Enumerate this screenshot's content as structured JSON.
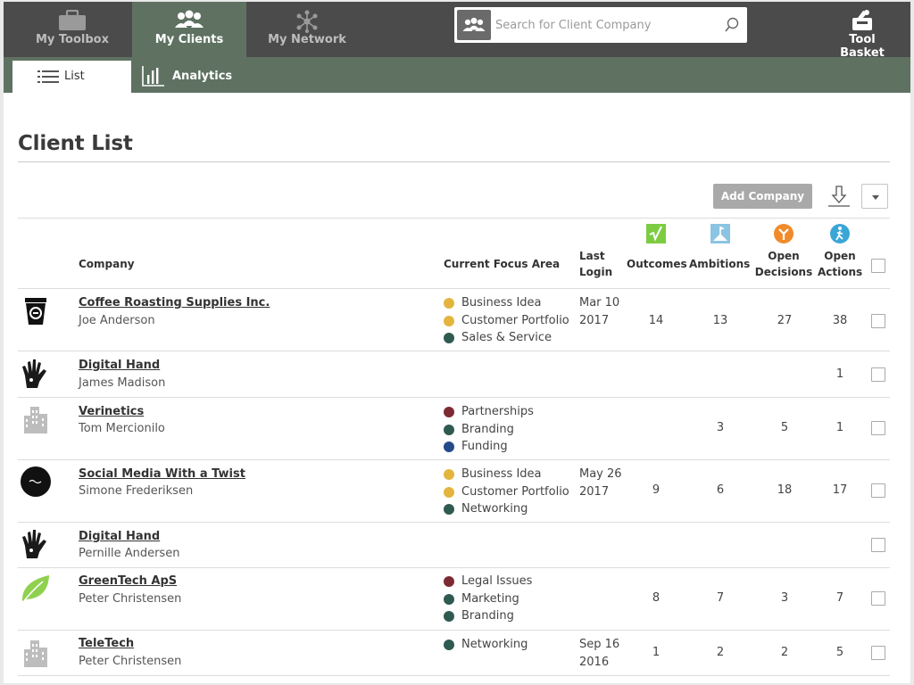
{
  "nav": {
    "toolbox": "My Toolbox",
    "clients": "My Clients",
    "network": "My Network",
    "basket": "Tool Basket"
  },
  "search": {
    "placeholder": "Search for Client Company"
  },
  "subnav": {
    "list": "List",
    "analytics": "Analytics"
  },
  "page": {
    "title": "Client List",
    "add_company": "Add Company"
  },
  "columns": {
    "company": "Company",
    "focus": "Current Focus Area",
    "last_login_1": "Last",
    "last_login_2": "Login",
    "outcomes": "Outcomes",
    "ambitions": "Ambitions",
    "decisions_1": "Open",
    "decisions_2": "Decisions",
    "actions_1": "Open",
    "actions_2": "Actions"
  },
  "colors": {
    "nav_bg": "#4b4b4b",
    "accent": "#5f7262",
    "focus_yellow": "#e3b53e",
    "focus_green": "#2f5a52",
    "focus_red": "#7d2b33",
    "focus_blue": "#244a8a",
    "outcomes_icon": "#7ccc41",
    "ambitions_icon": "#8cc4e3",
    "decisions_icon": "#f08a2a",
    "actions_icon": "#3aa6d6"
  },
  "rows": [
    {
      "logo": "coffee-cup-logo",
      "company": "Coffee Roasting Supplies Inc.",
      "contact": "Joe Anderson",
      "focus": [
        {
          "label": "Business Idea",
          "color": "#e3b53e"
        },
        {
          "label": "Customer Portfolio",
          "color": "#e3b53e"
        },
        {
          "label": "Sales & Service",
          "color": "#2f5a52"
        }
      ],
      "login": [
        "Mar 10",
        "2017"
      ],
      "outcomes": "14",
      "ambitions": "13",
      "decisions": "27",
      "actions": "38"
    },
    {
      "logo": "hand-print-logo",
      "company": "Digital Hand ",
      "contact": "James Madison",
      "focus": [],
      "login": [],
      "outcomes": "",
      "ambitions": "",
      "decisions": "",
      "actions": "1"
    },
    {
      "logo": "building-logo",
      "company": "Verinetics",
      "contact": "Tom Mercionilo",
      "focus": [
        {
          "label": "Partnerships",
          "color": "#7d2b33"
        },
        {
          "label": "Branding",
          "color": "#2f5a52"
        },
        {
          "label": "Funding",
          "color": "#244a8a"
        }
      ],
      "login": [],
      "outcomes": "",
      "ambitions": "3",
      "decisions": "5",
      "actions": "1"
    },
    {
      "logo": "twist-circle-logo",
      "company": "Social Media With a Twist",
      "contact": "Simone Frederiksen",
      "focus": [
        {
          "label": "Business Idea",
          "color": "#e3b53e"
        },
        {
          "label": "Customer Portfolio",
          "color": "#e3b53e"
        },
        {
          "label": "Networking",
          "color": "#2f5a52"
        }
      ],
      "login": [
        "May 26",
        "2017"
      ],
      "outcomes": "9",
      "ambitions": "6",
      "decisions": "18",
      "actions": "17"
    },
    {
      "logo": "hand-print-logo",
      "company": "Digital Hand ",
      "contact": "Pernille Andersen",
      "focus": [],
      "login": [],
      "outcomes": "",
      "ambitions": "",
      "decisions": "",
      "actions": ""
    },
    {
      "logo": "leaf-logo",
      "company": "GreenTech ApS",
      "contact": "Peter Christensen",
      "focus": [
        {
          "label": "Legal Issues",
          "color": "#7d2b33"
        },
        {
          "label": "Marketing",
          "color": "#2f5a52"
        },
        {
          "label": "Branding",
          "color": "#2f5a52"
        }
      ],
      "login": [],
      "outcomes": "8",
      "ambitions": "7",
      "decisions": "3",
      "actions": "7"
    },
    {
      "logo": "building-logo",
      "company": "TeleTech",
      "contact": "Peter Christensen",
      "focus": [
        {
          "label": "Networking",
          "color": "#2f5a52"
        }
      ],
      "login": [
        "Sep 16",
        "2016"
      ],
      "outcomes": "1",
      "ambitions": "2",
      "decisions": "2",
      "actions": "5"
    }
  ]
}
